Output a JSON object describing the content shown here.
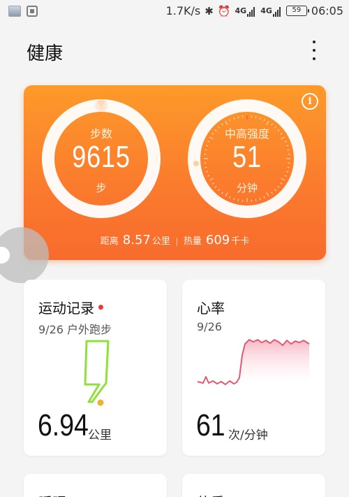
{
  "status_bar": {
    "net_speed": "1.7K/s",
    "net_type_1": "4G",
    "net_type_2": "4G",
    "battery": "59",
    "time": "06:05",
    "icons": [
      "image-thumbnail-icon",
      "gallery-icon",
      "bluetooth-icon",
      "alarm-icon",
      "signal-icon",
      "battery-icon"
    ]
  },
  "header": {
    "title": "健康",
    "menu_icon": "more-vertical-icon"
  },
  "summary": {
    "gradient_colors": [
      "#fd9a2a",
      "#f86b2d"
    ],
    "steps": {
      "label": "步数",
      "value": "9615",
      "unit": "步"
    },
    "intensity": {
      "label": "中高强度",
      "value": "51",
      "unit": "分钟"
    },
    "info_icon": "i",
    "stats": {
      "distance_label": "距离",
      "distance_value": "8.57",
      "distance_unit": "公里",
      "calories_label": "热量",
      "calories_value": "609",
      "calories_unit": "千卡"
    }
  },
  "cards": {
    "exercise": {
      "title": "运动记录",
      "subtitle": "9/26 户外跑步",
      "value": "6.94",
      "unit": "公里",
      "route_color": "#8ee03a",
      "badge_color": "#e8383c"
    },
    "heart_rate": {
      "title": "心率",
      "date": "9/26",
      "value": "61",
      "unit": "次/分钟",
      "line_color": "#e05a72"
    },
    "sleep": {
      "title": "睡眠"
    },
    "weight": {
      "title": "体重"
    }
  }
}
